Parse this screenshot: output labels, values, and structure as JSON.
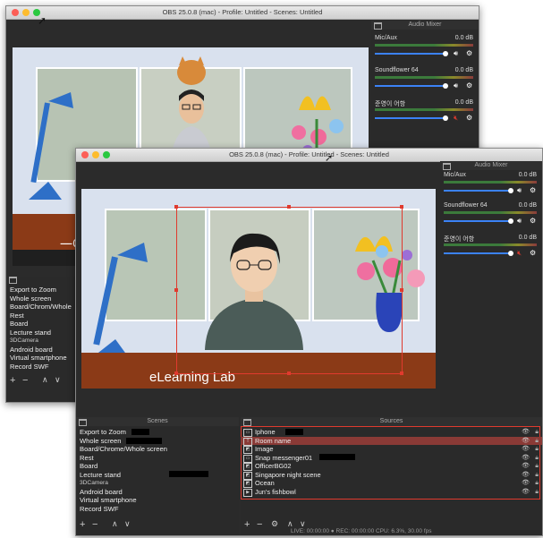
{
  "back_window": {
    "title": "OBS 25.0.8 (mac) - Profile: Untitled - Scenes: Untitled",
    "mixer_title": "Audio Mixer",
    "channels": [
      {
        "name": "Mic/Aux",
        "db": "0.0 dB",
        "muted": false
      },
      {
        "name": "Soundflower 64",
        "db": "0.0 dB",
        "muted": false
      },
      {
        "name": "준영이 어항",
        "db": "0.0 dB",
        "muted": true
      }
    ],
    "partial_text": "一아",
    "scenes": [
      "Export to Zoom",
      "Whole screen",
      "Board/Chrom/Whole",
      "Rest",
      "Board",
      "Lecture stand",
      "3DCamera",
      "Android board",
      "Virtual smartphone",
      "Record SWF"
    ]
  },
  "front_window": {
    "title": "OBS 25.0.8 (mac) - Profile: Untitled - Scenes: Untitled",
    "overlay_text": "eLearning Lab",
    "mixer_title": "Audio Mixer",
    "channels": [
      {
        "name": "Mic/Aux",
        "db": "0.0 dB",
        "muted": false
      },
      {
        "name": "Soundflower 64",
        "db": "0.0 dB",
        "muted": false
      },
      {
        "name": "준영이 어항",
        "db": "0.0 dB",
        "muted": true
      }
    ],
    "scenes_title": "Scenes",
    "sources_title": "Sources",
    "scenes": [
      "Export to Zoom",
      "Whole screen",
      "Board/Chrome/Whole screen",
      "Rest",
      "Board",
      "Lecture stand",
      "3DCamera",
      "Android board",
      "Virtual smartphone",
      "Record SWF"
    ],
    "sources": [
      "Iphone",
      "Room name",
      "Image",
      "Snap messenger01",
      "OfficerBG02",
      "Singapore night scene",
      "Ocean",
      "Jun's fishbowl"
    ],
    "status": "LIVE: 00:00:00  ● REC: 00:00:00   CPU: 6.3%, 30.00 fps"
  },
  "colors": {
    "selection": "#e03a2e",
    "accent_blue": "#3b82f6"
  }
}
